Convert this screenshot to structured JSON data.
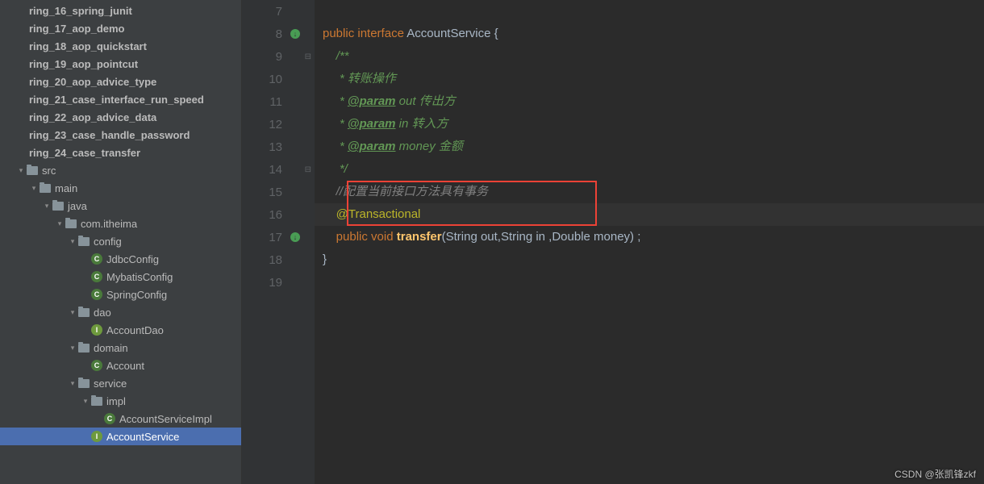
{
  "tree": [
    {
      "depth": 0,
      "arrow": "",
      "icon": "module",
      "label": "ring_16_spring_junit",
      "bold": true
    },
    {
      "depth": 0,
      "arrow": "",
      "icon": "module",
      "label": "ring_17_aop_demo",
      "bold": true
    },
    {
      "depth": 0,
      "arrow": "",
      "icon": "module",
      "label": "ring_18_aop_quickstart",
      "bold": true
    },
    {
      "depth": 0,
      "arrow": "",
      "icon": "module",
      "label": "ring_19_aop_pointcut",
      "bold": true
    },
    {
      "depth": 0,
      "arrow": "",
      "icon": "module",
      "label": "ring_20_aop_advice_type",
      "bold": true
    },
    {
      "depth": 0,
      "arrow": "",
      "icon": "module",
      "label": "ring_21_case_interface_run_speed",
      "bold": true
    },
    {
      "depth": 0,
      "arrow": "",
      "icon": "module",
      "label": "ring_22_aop_advice_data",
      "bold": true
    },
    {
      "depth": 0,
      "arrow": "",
      "icon": "module",
      "label": "ring_23_case_handle_password",
      "bold": true
    },
    {
      "depth": 0,
      "arrow": "",
      "icon": "module",
      "label": "ring_24_case_transfer",
      "bold": true
    },
    {
      "depth": 1,
      "arrow": "▾",
      "icon": "folder",
      "label": "src"
    },
    {
      "depth": 2,
      "arrow": "▾",
      "icon": "folder",
      "label": "main"
    },
    {
      "depth": 3,
      "arrow": "▾",
      "icon": "folder",
      "label": "java"
    },
    {
      "depth": 4,
      "arrow": "▾",
      "icon": "pkg",
      "label": "com.itheima"
    },
    {
      "depth": 5,
      "arrow": "▾",
      "icon": "pkg",
      "label": "config"
    },
    {
      "depth": 6,
      "arrow": "",
      "icon": "class",
      "label": "JdbcConfig"
    },
    {
      "depth": 6,
      "arrow": "",
      "icon": "class",
      "label": "MybatisConfig"
    },
    {
      "depth": 6,
      "arrow": "",
      "icon": "class",
      "label": "SpringConfig"
    },
    {
      "depth": 5,
      "arrow": "▾",
      "icon": "pkg",
      "label": "dao"
    },
    {
      "depth": 6,
      "arrow": "",
      "icon": "iface",
      "label": "AccountDao"
    },
    {
      "depth": 5,
      "arrow": "▾",
      "icon": "pkg",
      "label": "domain"
    },
    {
      "depth": 6,
      "arrow": "",
      "icon": "class",
      "label": "Account"
    },
    {
      "depth": 5,
      "arrow": "▾",
      "icon": "pkg",
      "label": "service"
    },
    {
      "depth": 6,
      "arrow": "▾",
      "icon": "pkg",
      "label": "impl"
    },
    {
      "depth": 7,
      "arrow": "",
      "icon": "class",
      "label": "AccountServiceImpl"
    },
    {
      "depth": 6,
      "arrow": "",
      "icon": "iface",
      "label": "AccountService",
      "selected": true
    }
  ],
  "gutter": [
    {
      "n": "7"
    },
    {
      "n": "8",
      "mark": "↓"
    },
    {
      "n": "9",
      "fold": "⊟"
    },
    {
      "n": "10"
    },
    {
      "n": "11"
    },
    {
      "n": "12"
    },
    {
      "n": "13"
    },
    {
      "n": "14",
      "fold": "⊟"
    },
    {
      "n": "15"
    },
    {
      "n": "16"
    },
    {
      "n": "17",
      "mark": "↓"
    },
    {
      "n": "18"
    },
    {
      "n": "19"
    }
  ],
  "code": {
    "l8_kw1": "public",
    "l8_kw2": "interface",
    "l8_name": "AccountService",
    "l8_brace": "{",
    "l9": "/**",
    "l10": " * 转账操作",
    "l11_pre": " * ",
    "l11_tag": "@param",
    "l11_post": " out 传出方",
    "l12_pre": " * ",
    "l12_tag": "@param",
    "l12_post": " in 转入方",
    "l13_pre": " * ",
    "l13_tag": "@param",
    "l13_post": " money 金额",
    "l14": " */",
    "l15": "//配置当前接口方法具有事务",
    "l16": "@Transactional",
    "l17_kw1": "public",
    "l17_kw2": "void",
    "l17_m": "transfer",
    "l17_sig": "(String out,String in ,Double money) ;",
    "l18": "}"
  },
  "watermark": "CSDN @张凯锋zkf"
}
